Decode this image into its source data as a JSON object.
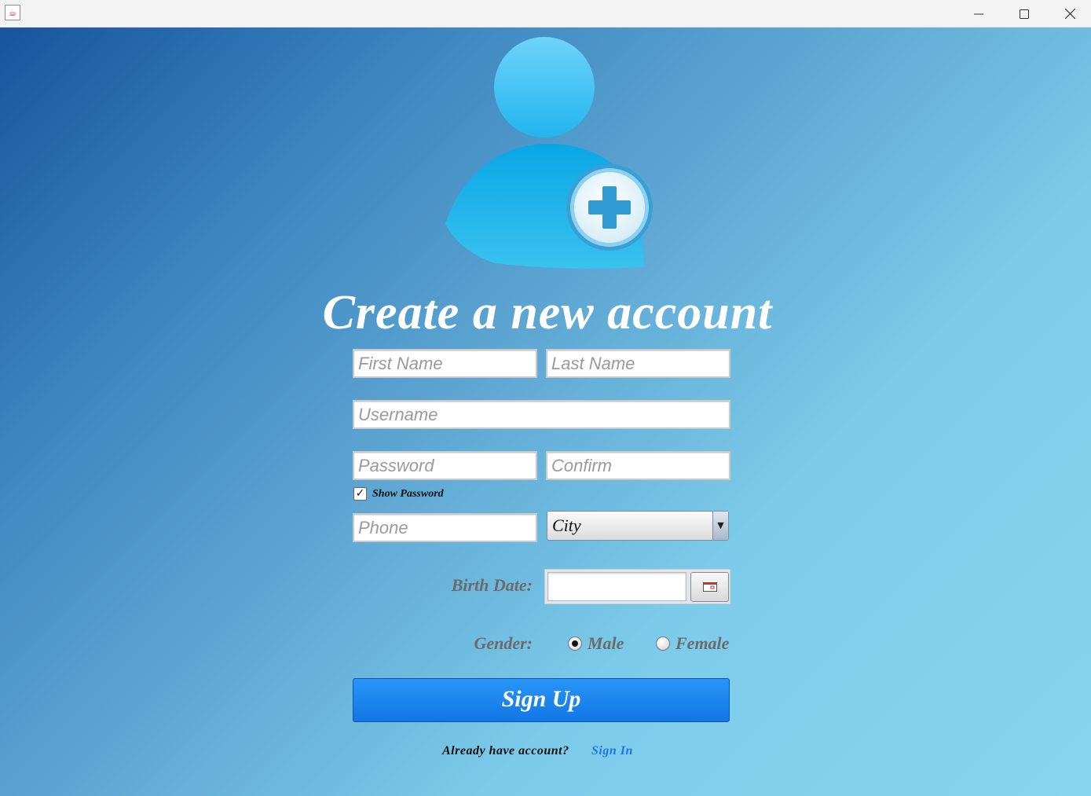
{
  "form": {
    "title": "Create a new account",
    "first_name_placeholder": "First Name",
    "last_name_placeholder": "Last Name",
    "username_placeholder": "Username",
    "password_placeholder": "Password",
    "confirm_placeholder": "Confirm",
    "show_password_label": "Show Password",
    "show_password_checked": true,
    "phone_placeholder": "Phone",
    "city_selected": "City",
    "birth_date_label": "Birth Date:",
    "birth_date_value": "",
    "gender_label": "Gender:",
    "gender_options": [
      "Male",
      "Female"
    ],
    "gender_selected": "Male",
    "signup_label": "Sign Up",
    "already_text": "Already have account?",
    "signin_label": "Sign In"
  },
  "colors": {
    "accent": "#1a78e6",
    "button": "#1b86ee",
    "label_gray": "#6b6b6b"
  },
  "icons": [
    "java-app-icon",
    "minimize-icon",
    "maximize-icon",
    "close-icon",
    "user-add-icon",
    "calendar-icon",
    "dropdown-arrow-icon"
  ]
}
